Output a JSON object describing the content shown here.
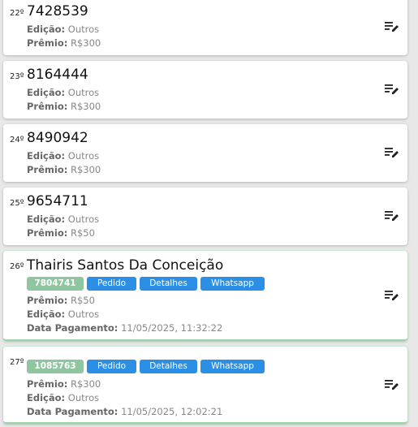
{
  "labels": {
    "edicao": "Edição:",
    "premio": "Prêmio:",
    "data_pagamento": "Data Pagamento:",
    "pedido": "Pedido",
    "detalhes": "Detalhes",
    "whatsapp": "Whatsapp"
  },
  "entries": [
    {
      "pos": "22º",
      "title": "7428539",
      "edicao": "Outros",
      "premio": "R$300"
    },
    {
      "pos": "23º",
      "title": "8164444",
      "edicao": "Outros",
      "premio": "R$300"
    },
    {
      "pos": "24º",
      "title": "8490942",
      "edicao": "Outros",
      "premio": "R$300"
    },
    {
      "pos": "25º",
      "title": "9654711",
      "edicao": "Outros",
      "premio": "R$50"
    },
    {
      "pos": "26º",
      "title": "Thairis Santos Da Conceição",
      "code": "7804741",
      "premio": "R$50",
      "edicao": "Outros",
      "data_pagamento": "11/05/2025, 11:32:22"
    },
    {
      "pos": "27º",
      "code": "1085763",
      "premio": "R$300",
      "edicao": "Outros",
      "data_pagamento": "11/05/2025, 12:02:21"
    }
  ],
  "colors": {
    "code_chip": "#8fc6a0",
    "action_button": "#2b8fe6",
    "paid_border": "#9fd3ad"
  },
  "icons": {
    "edit": "edit-note-icon"
  }
}
